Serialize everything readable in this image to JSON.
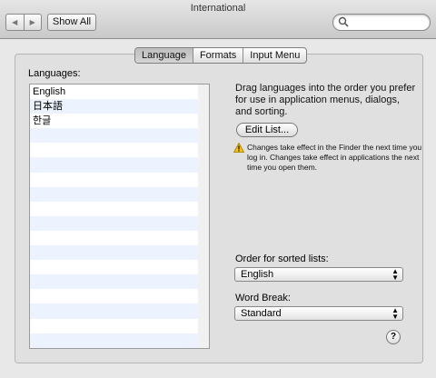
{
  "window": {
    "title": "International"
  },
  "toolbar": {
    "back_label": "◀",
    "forward_label": "▶",
    "show_all_label": "Show All",
    "search_placeholder": ""
  },
  "tabs": [
    {
      "label": "Language",
      "active": true
    },
    {
      "label": "Formats",
      "active": false
    },
    {
      "label": "Input Menu",
      "active": false
    }
  ],
  "languages": {
    "label": "Languages:",
    "items": [
      "English",
      "日本語",
      "한글",
      "",
      "",
      "",
      "",
      "",
      "",
      "",
      "",
      "",
      "",
      "",
      "",
      "",
      "",
      ""
    ]
  },
  "description": "Drag languages into the order you prefer for use in application menus, dialogs, and sorting.",
  "edit_list_label": "Edit List...",
  "warning": {
    "icon": "warning-icon",
    "text": "Changes take effect in the Finder the next time you log in. Changes take effect in applications the next time you open them."
  },
  "order": {
    "label": "Order for sorted lists:",
    "value": "English"
  },
  "word_break": {
    "label": "Word Break:",
    "value": "Standard"
  },
  "help_label": "?"
}
